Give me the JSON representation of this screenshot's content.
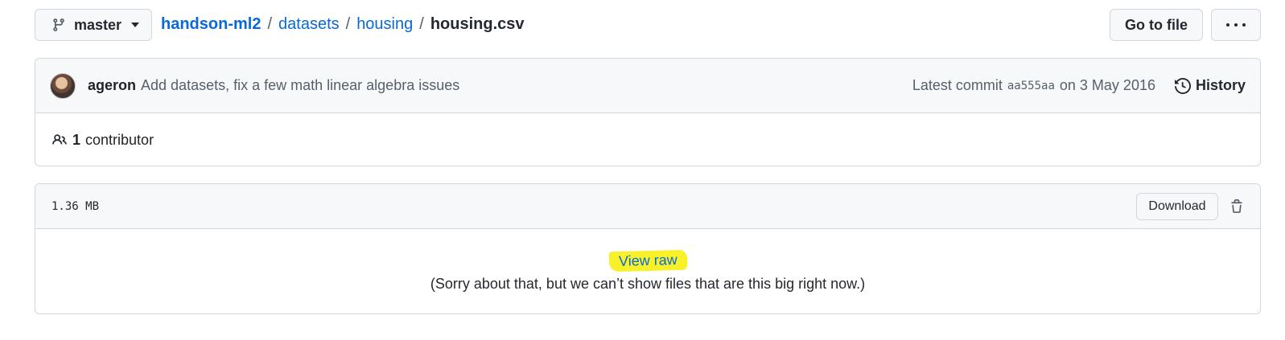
{
  "branch": {
    "label": "master",
    "icon": "git-branch-icon"
  },
  "breadcrumb": {
    "repo": "handson-ml2",
    "sep1": "/",
    "folder1": "datasets",
    "sep2": "/",
    "folder2": "housing",
    "sep3": "/",
    "file": "housing.csv"
  },
  "toolbar": {
    "goto_label": "Go to file",
    "more_icon": "kebab-horizontal-icon"
  },
  "commit": {
    "author": "ageron",
    "message": "Add datasets, fix a few math linear algebra issues",
    "latest_prefix": "Latest commit",
    "sha": "aa555aa",
    "date_text": "on 3 May 2016",
    "history_label": "History"
  },
  "contributors": {
    "count": "1",
    "label": "contributor"
  },
  "file": {
    "size": "1.36 MB",
    "download_label": "Download",
    "view_raw_label": "View raw",
    "too_big_message": "(Sorry about that, but we can’t show files that are this big right now.)"
  },
  "colors": {
    "link": "#0969da",
    "highlight": "#f8f12a",
    "border": "#d0d7de",
    "subtle_bg": "#f6f8fa"
  }
}
